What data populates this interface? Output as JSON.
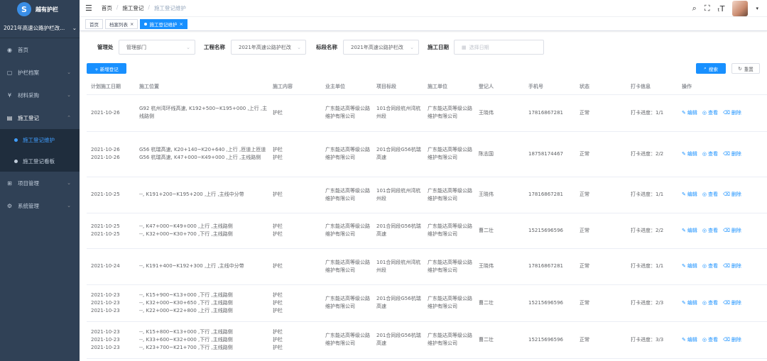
{
  "sidebar": {
    "logo_text": "越有护栏",
    "project": "2021年高速公路护栏改...",
    "menu": [
      {
        "label": "首页",
        "icon": "dashboard-icon"
      },
      {
        "label": "护栏档案",
        "icon": "archive-icon"
      },
      {
        "label": "材料采购",
        "icon": "purchase-icon"
      },
      {
        "label": "施工登记",
        "icon": "construction-icon"
      }
    ],
    "submenu": [
      {
        "label": "施工登记维护"
      },
      {
        "label": "施工登记看板"
      }
    ],
    "menu_bottom": [
      {
        "label": "项目管理",
        "icon": "project-icon"
      },
      {
        "label": "系统管理",
        "icon": "settings-icon"
      }
    ]
  },
  "navbar": {
    "breadcrumb": [
      "首页",
      "施工登记",
      "施工登记维护"
    ]
  },
  "tags": [
    "首页",
    "档案列表",
    "施工登记维护"
  ],
  "filters": {
    "manage_label": "管理处",
    "manage_value": "管理部门",
    "project_label": "工程名称",
    "project_value": "2021年高速公路护栏改",
    "section_label": "标段名称",
    "section_value": "2021年高速公路护栏改",
    "date_label": "施工日期",
    "date_placeholder": "选择日期"
  },
  "buttons": {
    "add": "+ 新增登记",
    "search": "搜索",
    "reset": "重置"
  },
  "table": {
    "headers": [
      "计划施工日期",
      "施工位置",
      "施工内容",
      "业主单位",
      "项目标段",
      "施工单位",
      "登记人",
      "手机号",
      "状态",
      "打卡信息",
      "操作"
    ],
    "ops": {
      "edit": "编辑",
      "view": "查看",
      "delete": "删除"
    },
    "rows": [
      {
        "date": "2021-10-26",
        "location": "G92 杭州湾环线高速, K192+500~K195+000 ,上行 ,主线路侧",
        "content": "护栏",
        "owner": "广东能达高等级公路维护有限公司",
        "section": "101合同段杭州湾杭州段",
        "builder": "广东能达高等级公路维护有限公司",
        "person": "王晓伟",
        "phone": "17816867281",
        "status": "正常",
        "clock": "打卡进度：1/1"
      },
      {
        "date": "2021-10-26\n2021-10-26",
        "location": "G56 杭瑞高速, K20+140~K20+640 ,上行 ,匝道上匝道\nG56 杭瑞高速, K47+000~K49+000 ,上行 ,主线路侧",
        "content": "护栏\n护栏",
        "owner": "广东能达高等级公路维护有限公司",
        "section": "201合同段G56杭瑞高速",
        "builder": "广东能达高等级公路维护有限公司",
        "person": "陈志国",
        "phone": "18758174467",
        "status": "正常",
        "clock": "打卡进度：2/2"
      },
      {
        "date": "2021-10-25",
        "location": "--, K191+200~K195+200 ,上行 ,主线中分带",
        "content": "护栏",
        "owner": "广东能达高等级公路维护有限公司",
        "section": "101合同段杭州湾杭州段",
        "builder": "广东能达高等级公路维护有限公司",
        "person": "王晓伟",
        "phone": "17816867281",
        "status": "正常",
        "clock": "打卡进度：1/1"
      },
      {
        "date": "2021-10-25\n2021-10-25",
        "location": "--, K47+000~K49+000 ,上行 ,主线路侧\n--, K32+000~K30+700 ,下行 ,主线路侧",
        "content": "护栏\n护栏",
        "owner": "广东能达高等级公路维护有限公司",
        "section": "201合同段G56杭瑞高速",
        "builder": "广东能达高等级公路维护有限公司",
        "person": "曹二壮",
        "phone": "15215696596",
        "status": "正常",
        "clock": "打卡进度：2/2"
      },
      {
        "date": "2021-10-24",
        "location": "--, K191+400~K192+300 ,上行 ,主线中分带",
        "content": "护栏",
        "owner": "广东能达高等级公路维护有限公司",
        "section": "101合同段杭州湾杭州段",
        "builder": "广东能达高等级公路维护有限公司",
        "person": "王晓伟",
        "phone": "17816867281",
        "status": "正常",
        "clock": "打卡进度：1/1"
      },
      {
        "date": "2021-10-23\n2021-10-23\n2021-10-23",
        "location": "--, K15+900~K13+000 ,下行 ,主线路侧\n--, K32+000~K30+650 ,下行 ,主线路侧\n--, K22+000~K22+800 ,上行 ,主线路侧",
        "content": "护栏\n护栏\n护栏",
        "owner": "广东能达高等级公路维护有限公司",
        "section": "201合同段G56杭瑞高速",
        "builder": "广东能达高等级公路维护有限公司",
        "person": "曹二壮",
        "phone": "15215696596",
        "status": "正常",
        "clock": "打卡进度：2/3"
      },
      {
        "date": "2021-10-23\n2021-10-23\n2021-10-23",
        "location": "--, K15+800~K13+000 ,下行 ,主线路侧\n--, K33+600~K32+000 ,下行 ,主线路侧\n--, K23+700~K21+700 ,下行 ,主线路侧",
        "content": "护栏\n护栏\n护栏",
        "owner": "广东能达高等级公路维护有限公司",
        "section": "201合同段G56杭瑞高速",
        "builder": "广东能达高等级公路维护有限公司",
        "person": "曹二壮",
        "phone": "15215696596",
        "status": "正常",
        "clock": "打卡进度：3/3"
      }
    ]
  }
}
